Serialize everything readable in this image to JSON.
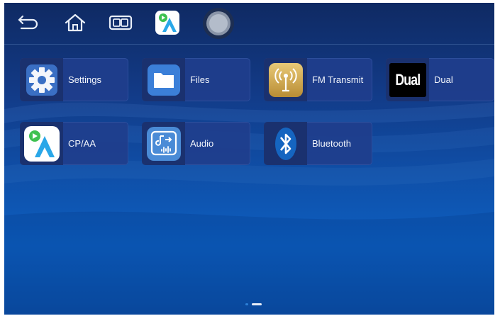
{
  "topbar": {
    "icons": [
      "back-arrow-icon",
      "home-icon",
      "multi-window-icon",
      "cpaa-app-icon",
      "assistive-touch-circle-icon"
    ]
  },
  "apps": [
    {
      "label": "Settings",
      "icon": "gear-icon"
    },
    {
      "label": "Files",
      "icon": "folder-icon"
    },
    {
      "label": "FM Transmit",
      "icon": "fm-antenna-icon"
    },
    {
      "label": "Dual",
      "icon": "dual-logo-icon",
      "logo_text": "Dual"
    },
    {
      "label": "CP/AA",
      "icon": "cpaa-icon"
    },
    {
      "label": "Audio",
      "icon": "audio-icon"
    },
    {
      "label": "Bluetooth",
      "icon": "bluetooth-icon"
    }
  ],
  "pager": {
    "pages": 2,
    "current": 2
  },
  "colors": {
    "accent": "#2d7fd6",
    "tile": "#203e8c",
    "background": "#0f4fa8"
  }
}
